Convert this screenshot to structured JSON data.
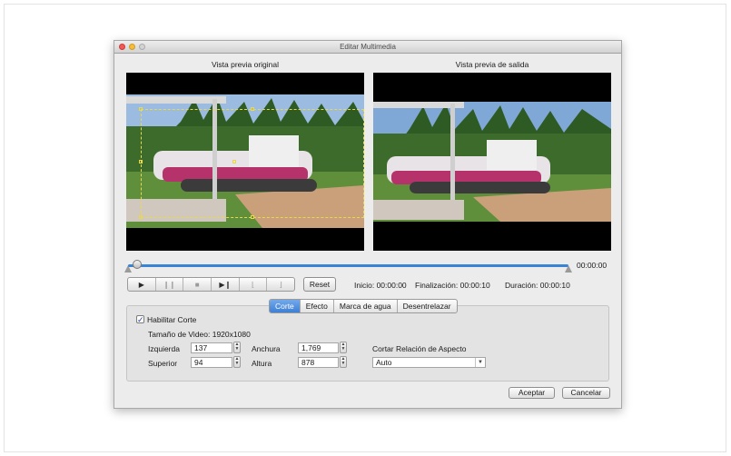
{
  "window": {
    "title": "Editar Multimedia"
  },
  "preview": {
    "original_label": "Vista previa original",
    "output_label": "Vista previa de salida"
  },
  "timeline": {
    "time_right": "00:00:00",
    "position_fraction": 0.0
  },
  "controls": {
    "play_icon": "play-icon",
    "pause_icon": "pause-icon",
    "stop_icon": "stop-icon",
    "next_frame_icon": "next-frame-icon",
    "mark_in_icon": "mark-in-icon",
    "mark_out_icon": "mark-out-icon",
    "reset_label": "Reset",
    "inicio": "Inicio: 00:00:00",
    "finalizacion": "Finalización: 00:00:10",
    "duracion": "Duración: 00:00:10"
  },
  "tabs": [
    {
      "label": "Corte",
      "active": true
    },
    {
      "label": "Efecto",
      "active": false
    },
    {
      "label": "Marca de agua",
      "active": false
    },
    {
      "label": "Desentrelazar",
      "active": false
    }
  ],
  "crop": {
    "enable_label": "Habilitar Corte",
    "enabled": true,
    "video_size": "Tamaño de Video: 1920x1080",
    "left_label": "Izquierda",
    "left_value": "137",
    "top_label": "Superior",
    "top_value": "94",
    "width_label": "Anchura",
    "width_value": "1,769",
    "height_label": "Altura",
    "height_value": "878",
    "aspect_label": "Cortar Relación de Aspecto",
    "aspect_value": "Auto"
  },
  "buttons": {
    "accept": "Aceptar",
    "cancel": "Cancelar"
  },
  "colors": {
    "accent": "#3d7fd6",
    "crop_frame": "#e8d84a"
  }
}
